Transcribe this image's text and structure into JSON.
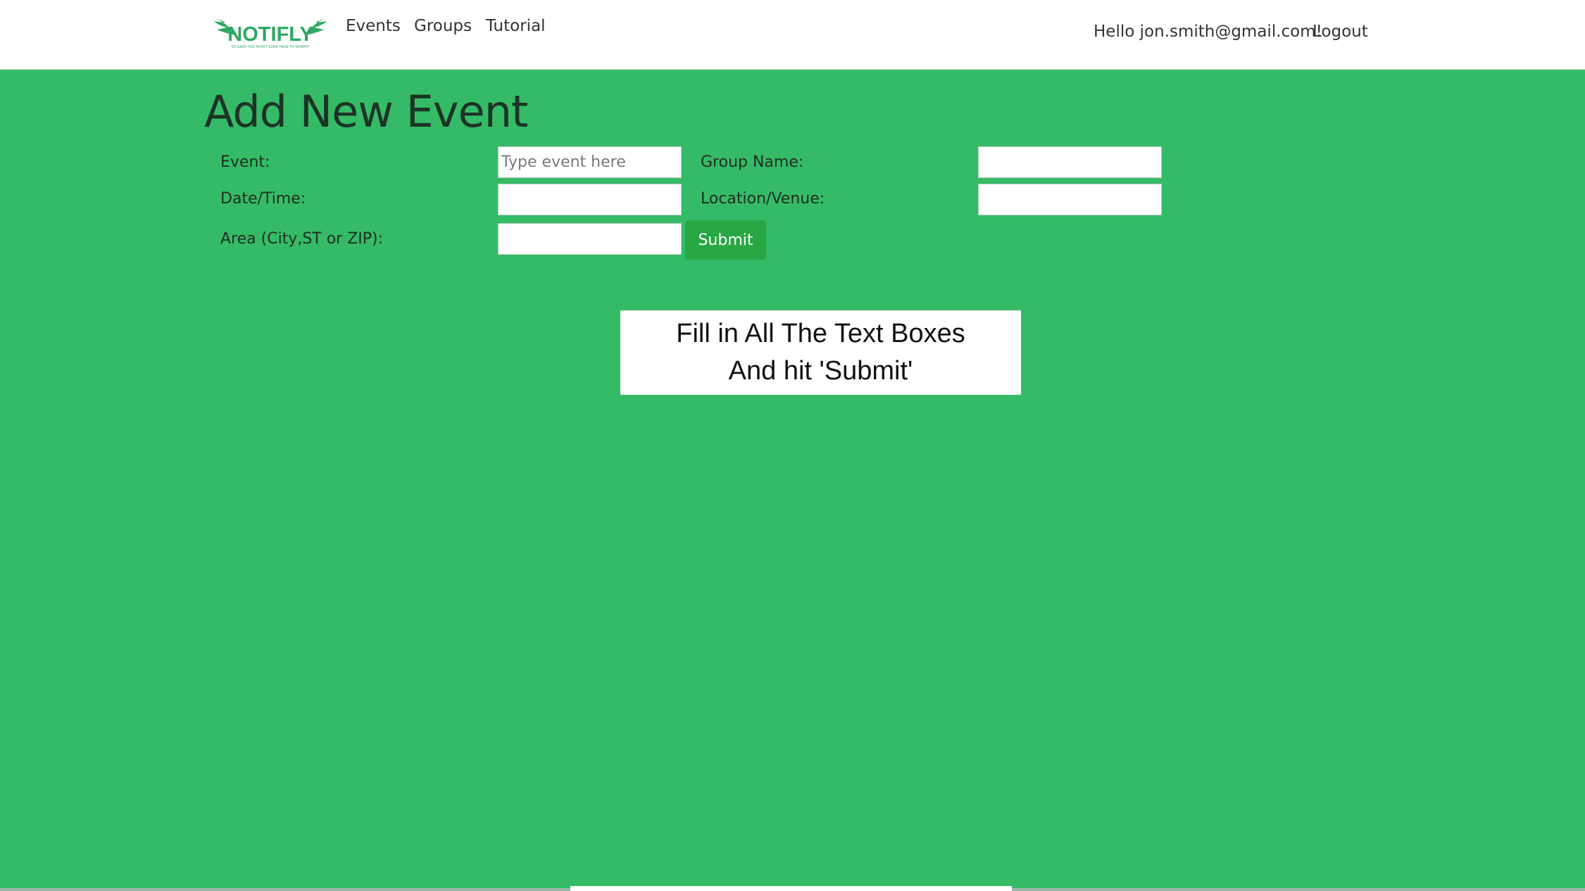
{
  "colors": {
    "page_background": "#35bb67",
    "navbar_background": "#ffffff",
    "logo_green": "#2ea862",
    "submit_button": "#28a745"
  },
  "navbar": {
    "logo_text": "NOTIFLY",
    "logo_tagline": "SO EASY YOU WON'T EVER HAVE TO WORRY!",
    "links": [
      {
        "label": "Events"
      },
      {
        "label": "Groups"
      },
      {
        "label": "Tutorial"
      }
    ],
    "greeting": "Hello jon.smith@gmail.com!",
    "logout_label": "Logout"
  },
  "page": {
    "title": "Add New Event"
  },
  "form": {
    "event_label": "Event:",
    "event_placeholder": "Type event here",
    "event_value": "",
    "group_name_label": "Group Name:",
    "group_name_value": "",
    "datetime_label": "Date/Time:",
    "datetime_value": "",
    "location_label": "Location/Venue:",
    "location_value": "",
    "area_label": "Area (City,ST or ZIP):",
    "area_value": "",
    "submit_label": "Submit"
  },
  "instructions": {
    "line1": "Fill in All The Text Boxes",
    "line2": "And hit 'Submit'"
  }
}
